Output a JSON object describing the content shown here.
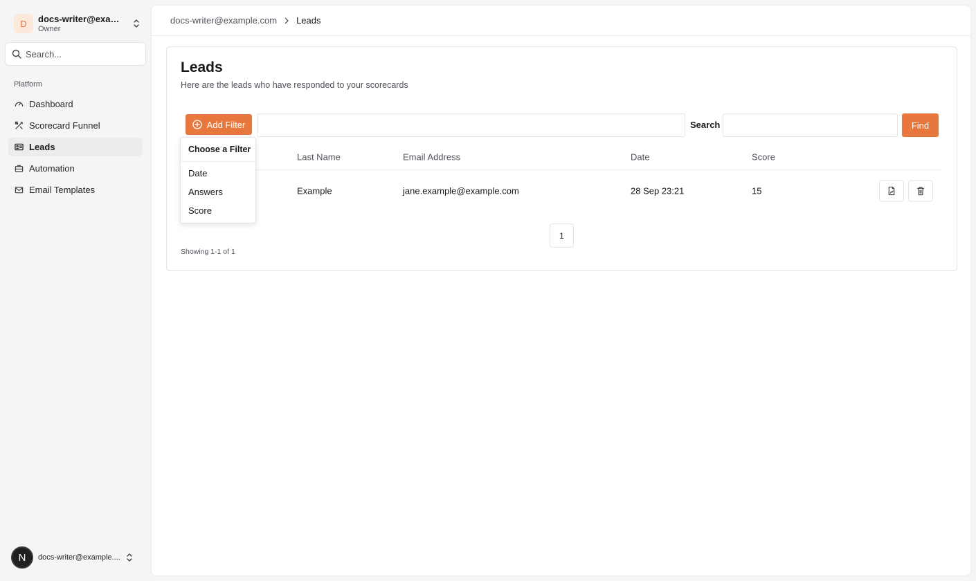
{
  "org": {
    "avatar_letter": "D",
    "name": "docs-writer@exam...",
    "role": "Owner"
  },
  "sidebar": {
    "search_placeholder": "Search...",
    "group_label": "Platform",
    "items": [
      {
        "label": "Dashboard",
        "icon": "gauge-icon",
        "active": false
      },
      {
        "label": "Scorecard Funnel",
        "icon": "tools-icon",
        "active": false
      },
      {
        "label": "Leads",
        "icon": "contact-card-icon",
        "active": true
      },
      {
        "label": "Automation",
        "icon": "briefcase-icon",
        "active": false
      },
      {
        "label": "Email Templates",
        "icon": "mail-icon",
        "active": false
      }
    ]
  },
  "user": {
    "avatar_letter": "N",
    "name": "docs-writer@example...."
  },
  "breadcrumb": {
    "parent": "docs-writer@example.com",
    "current": "Leads"
  },
  "page": {
    "title": "Leads",
    "description": "Here are the leads who have responded to your scorecards"
  },
  "toolbar": {
    "add_filter_label": "Add Filter",
    "search_label": "Search",
    "find_label": "Find"
  },
  "filter_menu": {
    "title": "Choose a Filter",
    "options": [
      "Date",
      "Answers",
      "Score"
    ]
  },
  "table": {
    "columns": [
      "Last Name",
      "Email Address",
      "Date",
      "Score"
    ],
    "rows": [
      {
        "last_name": "Example",
        "email": "jane.example@example.com",
        "date": "28 Sep 23:21",
        "score": "15"
      }
    ]
  },
  "pagination": {
    "current_page": "1",
    "showing_text": "Showing 1-1 of 1"
  },
  "colors": {
    "accent": "#e8773d",
    "sidebar_bg": "#f5f5f5",
    "active_item_bg": "#ececec"
  }
}
